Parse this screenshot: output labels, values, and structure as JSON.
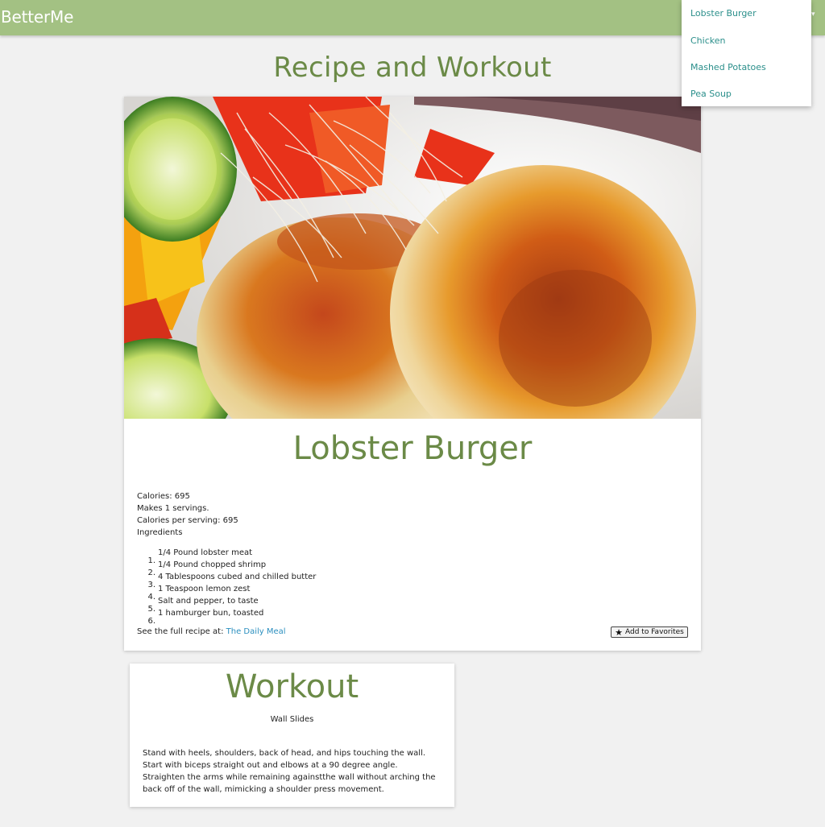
{
  "navbar": {
    "brand": "BetterMe",
    "caret": "▾",
    "background": "#a3c183"
  },
  "dropdown": {
    "items": [
      "Lobster Burger",
      "Chicken",
      "Mashed Potatoes",
      "Pea Soup"
    ],
    "link_color": "#2b8f8b"
  },
  "page": {
    "title": "Recipe and Workout",
    "title_color": "#6b8a47"
  },
  "recipe": {
    "name": "Lobster Burger",
    "calories": "Calories: 695",
    "servings": "Makes 1 servings.",
    "calories_per_serving": "Calories per serving: 695",
    "ingredients_label": "Ingredients",
    "ingredients": [
      "1/4 Pound lobster meat",
      "1/4 Pound chopped shrimp",
      "4 Tablespoons cubed and chilled butter",
      "1 Teaspoon lemon zest",
      "Salt and pepper, to taste",
      "1 hamburger bun, toasted"
    ],
    "ingredient_numbers": [
      "1.",
      "2.",
      "3.",
      "4.",
      "5.",
      "6."
    ],
    "source_prefix": "See the full recipe at:",
    "source_link": "The Daily Meal",
    "favorite_label": "Add to Favorites",
    "favorite_icon": "star-icon"
  },
  "workout": {
    "title": "Workout",
    "exercise_name": "Wall Slides",
    "description": "Stand with heels,  shoulders, back of head,  and hips touching the wall. Start with biceps straight out and elbows at a 90 degree angle. Straighten the arms while remaining againstthe wall without arching the back off of the wall, mimicking a shoulder press movement."
  }
}
